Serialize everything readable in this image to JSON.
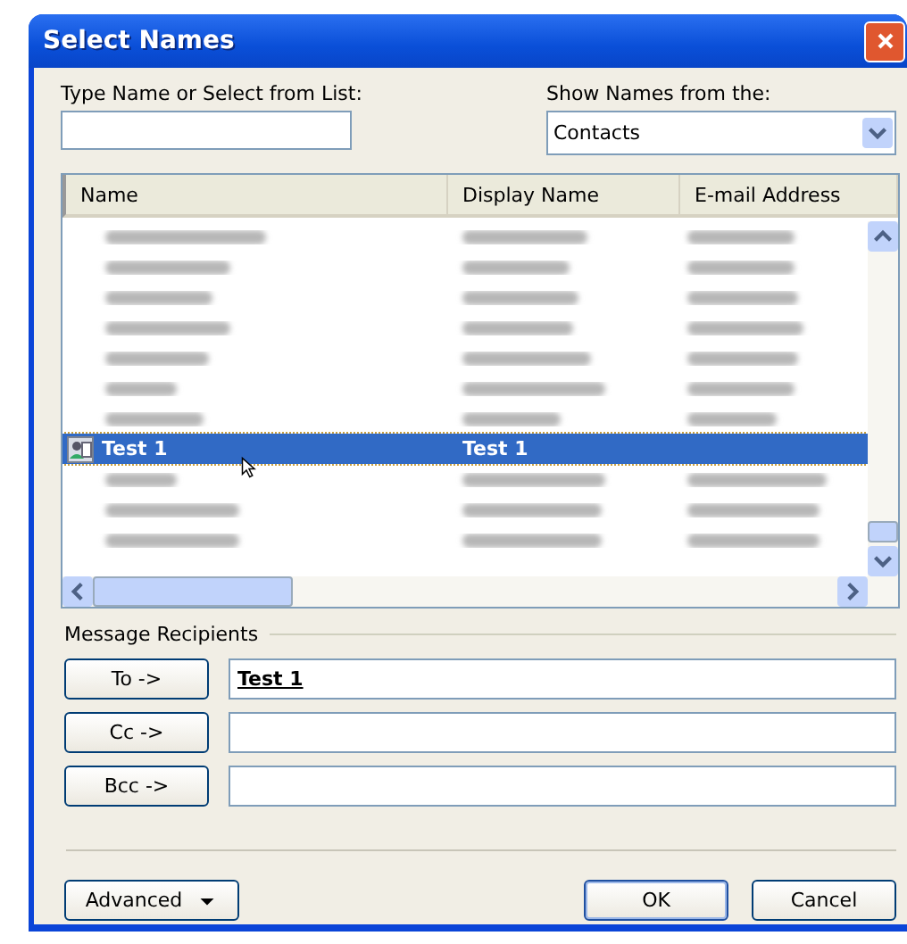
{
  "window": {
    "title": "Select Names"
  },
  "search": {
    "label": "Type Name or Select from List:"
  },
  "source": {
    "label": "Show Names from the:",
    "value": "Contacts"
  },
  "list": {
    "columns": [
      "Name",
      "Display Name",
      "E-mail Address"
    ],
    "rows": [
      {
        "kind": "blurred",
        "selected": false
      },
      {
        "kind": "blurred",
        "selected": false
      },
      {
        "kind": "blurred",
        "selected": false
      },
      {
        "kind": "blurred",
        "selected": false
      },
      {
        "kind": "blurred",
        "selected": false
      },
      {
        "kind": "blurred",
        "selected": false
      },
      {
        "kind": "blurred",
        "selected": false
      },
      {
        "kind": "contact",
        "name": "Test 1",
        "display_name": "Test 1",
        "selected": true
      },
      {
        "kind": "blurred",
        "selected": false
      },
      {
        "kind": "blurred",
        "selected": false
      },
      {
        "kind": "blurred",
        "selected": false
      }
    ]
  },
  "recipients": {
    "title": "Message Recipients",
    "fields": [
      {
        "button": "To ->",
        "value": "Test 1"
      },
      {
        "button": "Cc ->"
      },
      {
        "button": "Bcc ->"
      }
    ]
  },
  "buttons": {
    "advanced": "Advanced",
    "ok": "OK",
    "cancel": "Cancel"
  }
}
